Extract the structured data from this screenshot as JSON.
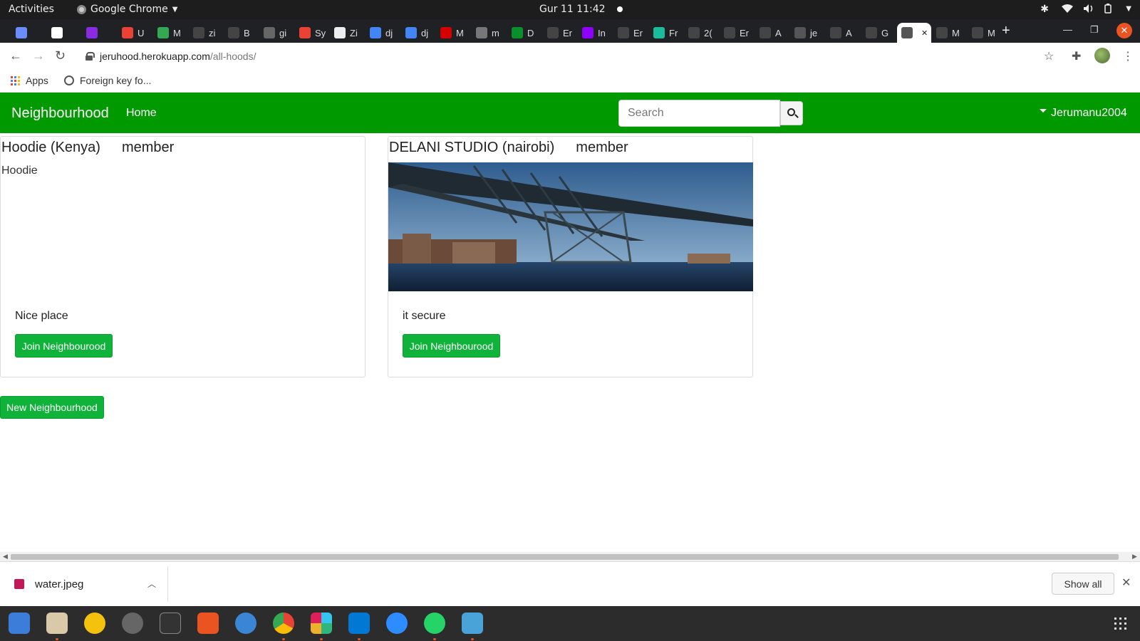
{
  "os": {
    "activities": "Activities",
    "app_menu": "Google Chrome",
    "clock": "Gur 11  11:42"
  },
  "browser": {
    "tabs": [
      {
        "label": "",
        "color": "#6a8cff"
      },
      {
        "label": "",
        "color": "#ffffff"
      },
      {
        "label": "",
        "color": "#8a2be2"
      },
      {
        "label": "U",
        "color": "#ea4335"
      },
      {
        "label": "M",
        "color": "#34a853"
      },
      {
        "label": "zi",
        "color": "#444444"
      },
      {
        "label": "B",
        "color": "#444444"
      },
      {
        "label": "gi",
        "color": "#666666"
      },
      {
        "label": "Sy",
        "color": "#ea4335"
      },
      {
        "label": "Zi",
        "color": "#eeeeee"
      },
      {
        "label": "dj",
        "color": "#4285f4"
      },
      {
        "label": "dj",
        "color": "#4285f4"
      },
      {
        "label": "M",
        "color": "#d50000"
      },
      {
        "label": "m",
        "color": "#777777"
      },
      {
        "label": "D",
        "color": "#0a8f2a"
      },
      {
        "label": "Er",
        "color": "#444444"
      },
      {
        "label": "In",
        "color": "#8f00ff"
      },
      {
        "label": "Er",
        "color": "#444444"
      },
      {
        "label": "Fr",
        "color": "#1abc9c"
      },
      {
        "label": "2(",
        "color": "#444444"
      },
      {
        "label": "Er",
        "color": "#444444"
      },
      {
        "label": "A",
        "color": "#444444"
      },
      {
        "label": "je",
        "color": "#555555"
      },
      {
        "label": "A",
        "color": "#444444"
      },
      {
        "label": "G",
        "color": "#444444"
      },
      {
        "label": "",
        "color": "#555555",
        "active": true
      },
      {
        "label": "M",
        "color": "#444444"
      },
      {
        "label": "M",
        "color": "#444444"
      }
    ],
    "url_host": "jeruhood.herokuapp.com",
    "url_path": "/all-hoods/",
    "bookmarks": [
      {
        "label": "Apps"
      },
      {
        "label": "Foreign key fo..."
      }
    ]
  },
  "site": {
    "brand": "Neighbourhood",
    "nav_home": "Home",
    "search_placeholder": "Search",
    "search_value": "",
    "user": "Jerumanu2004",
    "hoods": [
      {
        "name": "Hoodie (Kenya)",
        "status": "member",
        "image_alt": "Hoodie",
        "image_broken": true,
        "description": "Nice place",
        "join_label": "Join Neighbourood"
      },
      {
        "name": "DELANI STUDIO (nairobi)",
        "status": "member",
        "image_alt": "",
        "image_broken": false,
        "description": "it secure",
        "join_label": "Join Neighbourood"
      }
    ],
    "new_button": "New Neighbourhood"
  },
  "downloads": {
    "file": "water.jpeg",
    "show_all": "Show all"
  },
  "colors": {
    "navbar": "#009a00",
    "button": "#10b33a",
    "accent": "#e95420"
  }
}
